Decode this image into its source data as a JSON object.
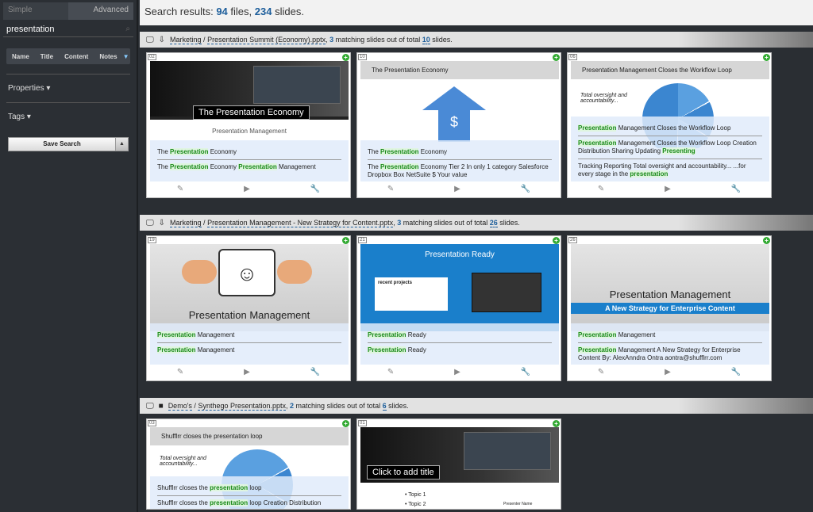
{
  "sidebar": {
    "mode_simple": "Simple",
    "mode_advanced": "Advanced",
    "search_value": "presentation",
    "field_tabs": [
      "Name",
      "Title",
      "Content",
      "Notes"
    ],
    "properties_label": "Properties",
    "tags_label": "Tags",
    "save_search_label": "Save Search"
  },
  "results": {
    "prefix": "Search results: ",
    "files": "94",
    "files_word": " files, ",
    "slides": "234",
    "slides_word": " slides."
  },
  "groups": [
    {
      "folder": "Marketing",
      "file": "Presentation Summit (Economy).pptx",
      "matching": "3",
      "total": "10",
      "cards": [
        {
          "num": "02",
          "thumb_caption": "The Presentation Economy",
          "thumb_sub": "Presentation Management",
          "snippets": [
            [
              "The ",
              "Presentation",
              " Economy"
            ],
            [
              "The ",
              "Presentation",
              " Economy ",
              "Presentation",
              " Management"
            ]
          ]
        },
        {
          "num": "10",
          "thumb_caption": "The Presentation Economy",
          "thumb_sub": "$",
          "snippets": [
            [
              "The ",
              "Presentation",
              " Economy"
            ],
            [
              "The ",
              "Presentation",
              " Economy Tier 2 In only 1 category Salesforce Dropbox Box NetSuite $ Your value"
            ]
          ]
        },
        {
          "num": "06",
          "thumb_caption": "Presentation Management Closes the Workflow Loop",
          "thumb_sub": "Total oversight and accountability...",
          "snippets": [
            [
              "",
              "Presentation",
              " Management Closes the Workflow Loop"
            ],
            [
              "",
              "Presentation",
              " Management Closes the Workflow Loop Creation Distribution Sharing Updating ",
              "Presenting",
              ""
            ],
            [
              "Tracking Reporting Total oversight and accountability... ...for every stage in the ",
              "presentation",
              ""
            ]
          ]
        }
      ]
    },
    {
      "folder": "Marketing",
      "file": "Presentation Management - New Strategy for Content.pptx",
      "matching": "3",
      "total": "26",
      "cards": [
        {
          "num": "19",
          "thumb_caption": "Presentation Management",
          "thumb_sub": "",
          "snippets": [
            [
              "",
              "Presentation",
              " Management"
            ],
            [
              "",
              "Presentation",
              " Management"
            ]
          ]
        },
        {
          "num": "21",
          "thumb_caption": "Presentation Ready",
          "thumb_sub": "recent projects",
          "snippets": [
            [
              "",
              "Presentation",
              " Ready"
            ],
            [
              "",
              "Presentation",
              " Ready"
            ]
          ]
        },
        {
          "num": "26",
          "thumb_caption": "Presentation Management",
          "thumb_sub": "A New Strategy for Enterprise Content",
          "snippets": [
            [
              "",
              "Presentation",
              " Management"
            ],
            [
              "",
              "Presentation",
              " Management A New Strategy for Enterprise Content By: AlexAnndra Ontra aontra@shufflrr.com"
            ]
          ]
        }
      ]
    },
    {
      "folder": "Demo's",
      "file": "Synthego Presentation.pptx",
      "matching": "2",
      "total": "6",
      "cards": [
        {
          "num": "03",
          "thumb_caption": "Shufflrr closes the presentation loop",
          "thumb_sub": "Total oversight and accountability...",
          "snippets": [
            [
              "Shufflrr closes the ",
              "presentation",
              " loop"
            ],
            [
              "Shufflrr closes the ",
              "presentation",
              " loop Creation Distribution"
            ]
          ]
        },
        {
          "num": "01",
          "thumb_caption": "Click to add title",
          "thumb_sub": "Presenter Name",
          "snippets": [
            [
              "Topic 1"
            ],
            [
              "Topic 2"
            ]
          ]
        }
      ]
    }
  ],
  "labels": {
    "slash": " / ",
    "matching_text": " matching slides out of total ",
    "slides_end": " slides."
  },
  "colors": {
    "accent": "#1d5e9b",
    "highlight": "#1a8a1a",
    "add": "#33aa33"
  }
}
